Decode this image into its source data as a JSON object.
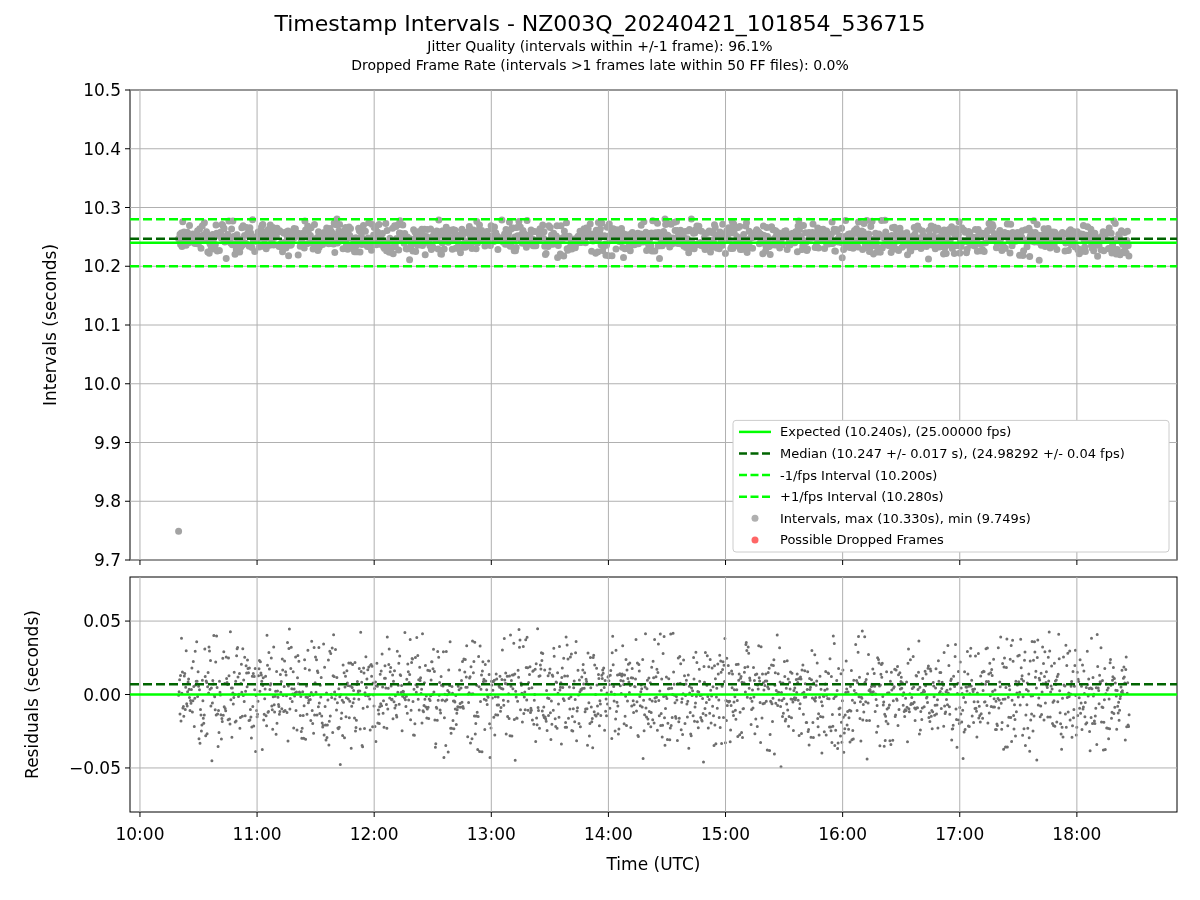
{
  "title": "Timestamp Intervals - NZ003Q_20240421_101854_536715",
  "subtitles": [
    "Jitter Quality (intervals within +/-1 frame): 96.1%",
    "Dropped Frame Rate (intervals >1 frames late within 50 FF files): 0.0%"
  ],
  "intervals_chart": {
    "chart_data": {
      "type": "line",
      "ylabel": "Intervals (seconds)",
      "x": [
        9.915,
        18.855
      ],
      "xlim": [
        9.915,
        18.855
      ],
      "ylim": [
        9.7,
        10.5
      ],
      "grid": true,
      "legend": true,
      "yticks": [
        {
          "value": 9.7,
          "label": "9.7"
        },
        {
          "value": 9.8,
          "label": "9.8"
        },
        {
          "value": 9.9,
          "label": "9.9"
        },
        {
          "value": 10,
          "label": "10.0"
        },
        {
          "value": 10.1,
          "label": "10.1"
        },
        {
          "value": 10.2,
          "label": "10.2"
        },
        {
          "value": 10.3,
          "label": "10.3"
        },
        {
          "value": 10.4,
          "label": "10.4"
        },
        {
          "value": 10.5,
          "label": "10.5"
        }
      ],
      "series": [
        {
          "name": "Expected (10.240s), (25.00000 fps)",
          "color": "#00ff00",
          "line_style": "solid",
          "values": [
            10.24,
            10.24
          ]
        },
        {
          "name": "Median (10.247 +/- 0.017 s), (24.98292 +/- 0.04 fps)",
          "color": "#006400",
          "line_style": "dashed",
          "values": [
            10.247,
            10.247
          ]
        },
        {
          "name": "-1/fps Interval (10.200s)",
          "color": "#00ff00",
          "line_style": "dashed",
          "values": [
            10.2,
            10.2
          ]
        },
        {
          "name": "+1/fps Interval (10.280s)",
          "color": "#00ff00",
          "line_style": "dashed",
          "values": [
            10.28,
            10.28
          ]
        }
      ]
    },
    "marker_legend": [
      {
        "label": "Intervals, max (10.330s), min (9.749s)",
        "color": "#b0b0b0"
      },
      {
        "label": "Possible Dropped Frames",
        "color": "#ff6666"
      }
    ]
  },
  "residuals_chart": {
    "chart_data": {
      "type": "line",
      "ylabel": "Residuals (seconds)",
      "xlabel": "Time (UTC)",
      "xlim": [
        9.915,
        18.855
      ],
      "ylim": [
        -0.08,
        0.08
      ],
      "grid": true,
      "xticks": [
        {
          "value": 10,
          "label": "10:00"
        },
        {
          "value": 11,
          "label": "11:00"
        },
        {
          "value": 12,
          "label": "12:00"
        },
        {
          "value": 13,
          "label": "13:00"
        },
        {
          "value": 14,
          "label": "14:00"
        },
        {
          "value": 15,
          "label": "15:00"
        },
        {
          "value": 16,
          "label": "16:00"
        },
        {
          "value": 17,
          "label": "17:00"
        },
        {
          "value": 18,
          "label": "18:00"
        }
      ],
      "yticks": [
        {
          "value": -0.05,
          "label": "−0.05"
        },
        {
          "value": 0,
          "label": "0.00"
        },
        {
          "value": 0.05,
          "label": "0.05"
        }
      ],
      "x": [
        9.915,
        18.855
      ],
      "series": [
        {
          "color": "#00ff00",
          "line_style": "solid",
          "values": [
            0,
            0
          ]
        },
        {
          "color": "#006400",
          "line_style": "dashed",
          "values": [
            0.007,
            0.007
          ]
        }
      ]
    }
  }
}
